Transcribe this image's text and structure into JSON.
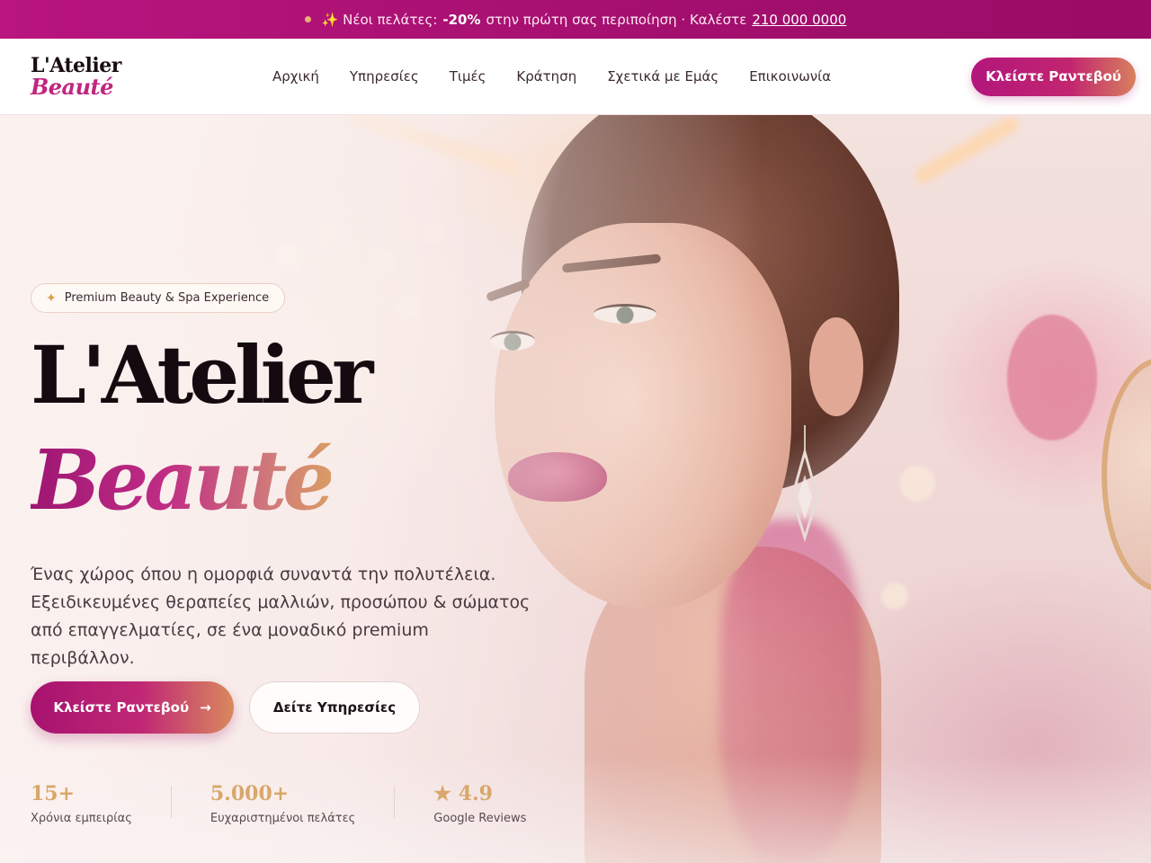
{
  "promo": {
    "prefix": "✨ Νέοι πελάτες:",
    "discount": "-20%",
    "middle": "στην πρώτη σας περιποίηση · Καλέστε",
    "phone": "210 000 0000"
  },
  "nav": {
    "logo_line1": "L'Atelier",
    "logo_line2": "Beauté",
    "items": [
      "Αρχική",
      "Υπηρεσίες",
      "Τιμές",
      "Κράτηση",
      "Σχετικά με Εμάς",
      "Επικοινωνία"
    ],
    "cta": "Κλείστε Ραντεβού"
  },
  "hero": {
    "badge": "Premium Beauty & Spa Experience",
    "title_line1": "L'Atelier",
    "title_line2": "Beauté",
    "description": "Ένας χώρος όπου η ομορφιά συναντά την πολυτέλεια. Εξειδικευμένες θεραπείες μαλλιών, προσώπου & σώματος από επαγγελματίες, σε ένα μοναδικό premium περιβάλλον.",
    "primary_button": "Κλείστε Ραντεβού",
    "secondary_button": "Δείτε Υπηρεσίες",
    "stats": [
      {
        "value": "15+",
        "label": "Χρόνια εμπειρίας"
      },
      {
        "value": "5.000+",
        "label": "Ευχαριστημένοι πελάτες"
      },
      {
        "value": "4.9",
        "label": "Google Reviews"
      }
    ]
  },
  "icons": {
    "promo_dot": "dot-icon",
    "badge": "sparkles-icon",
    "primary_arrow": "arrow-right-icon",
    "rating": "star-icon"
  },
  "colors": {
    "brand": "#b3167c",
    "gold": "#d8a76a"
  }
}
